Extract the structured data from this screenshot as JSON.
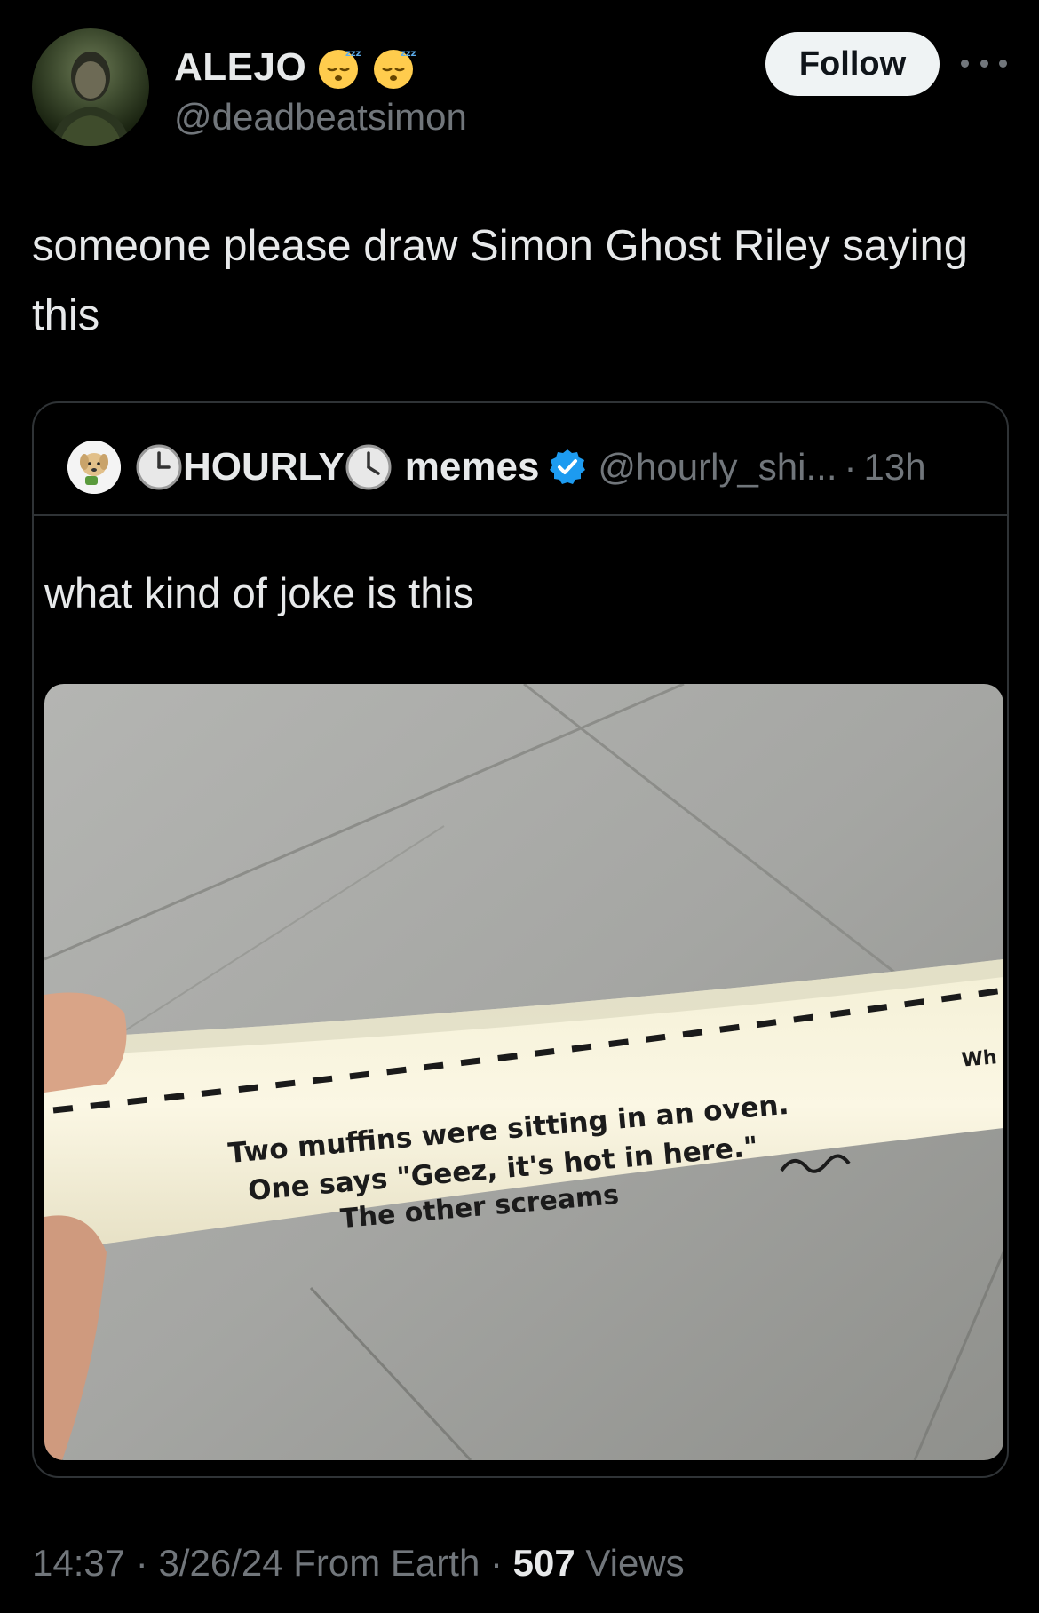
{
  "post": {
    "author": {
      "name": "ALEJO",
      "handle": "@deadbeatsimon",
      "emoji": [
        "sleeping-face",
        "sleeping-face"
      ]
    },
    "follow_label": "Follow",
    "text": "someone please draw Simon Ghost Riley saying this",
    "quoted": {
      "name_prefix": "HOURLY",
      "name_suffix": "memes",
      "handle": "@hourly_shi...",
      "separator": "·",
      "time": "13h",
      "text": "what kind of joke is this",
      "image_text": {
        "line1": "Two muffins were sitting in an oven.",
        "line2": "One says \"Geez, it's hot in here.\"",
        "line3": "The other screams",
        "edge": "Wh"
      }
    },
    "meta": {
      "time": "14:37",
      "sep1": "·",
      "date": "3/26/24",
      "source": "From Earth",
      "sep2": "·",
      "views_count": "507",
      "views_label": "Views"
    }
  },
  "colors": {
    "background": "#000000",
    "text": "#e7e9ea",
    "muted": "#71767b",
    "border": "#2f3336",
    "verified": "#1d9bf0",
    "follow_bg": "#eff3f4"
  },
  "icons": [
    "avatar",
    "sleeping-face-emoji",
    "more-icon",
    "clock-emoji",
    "verified-icon"
  ]
}
